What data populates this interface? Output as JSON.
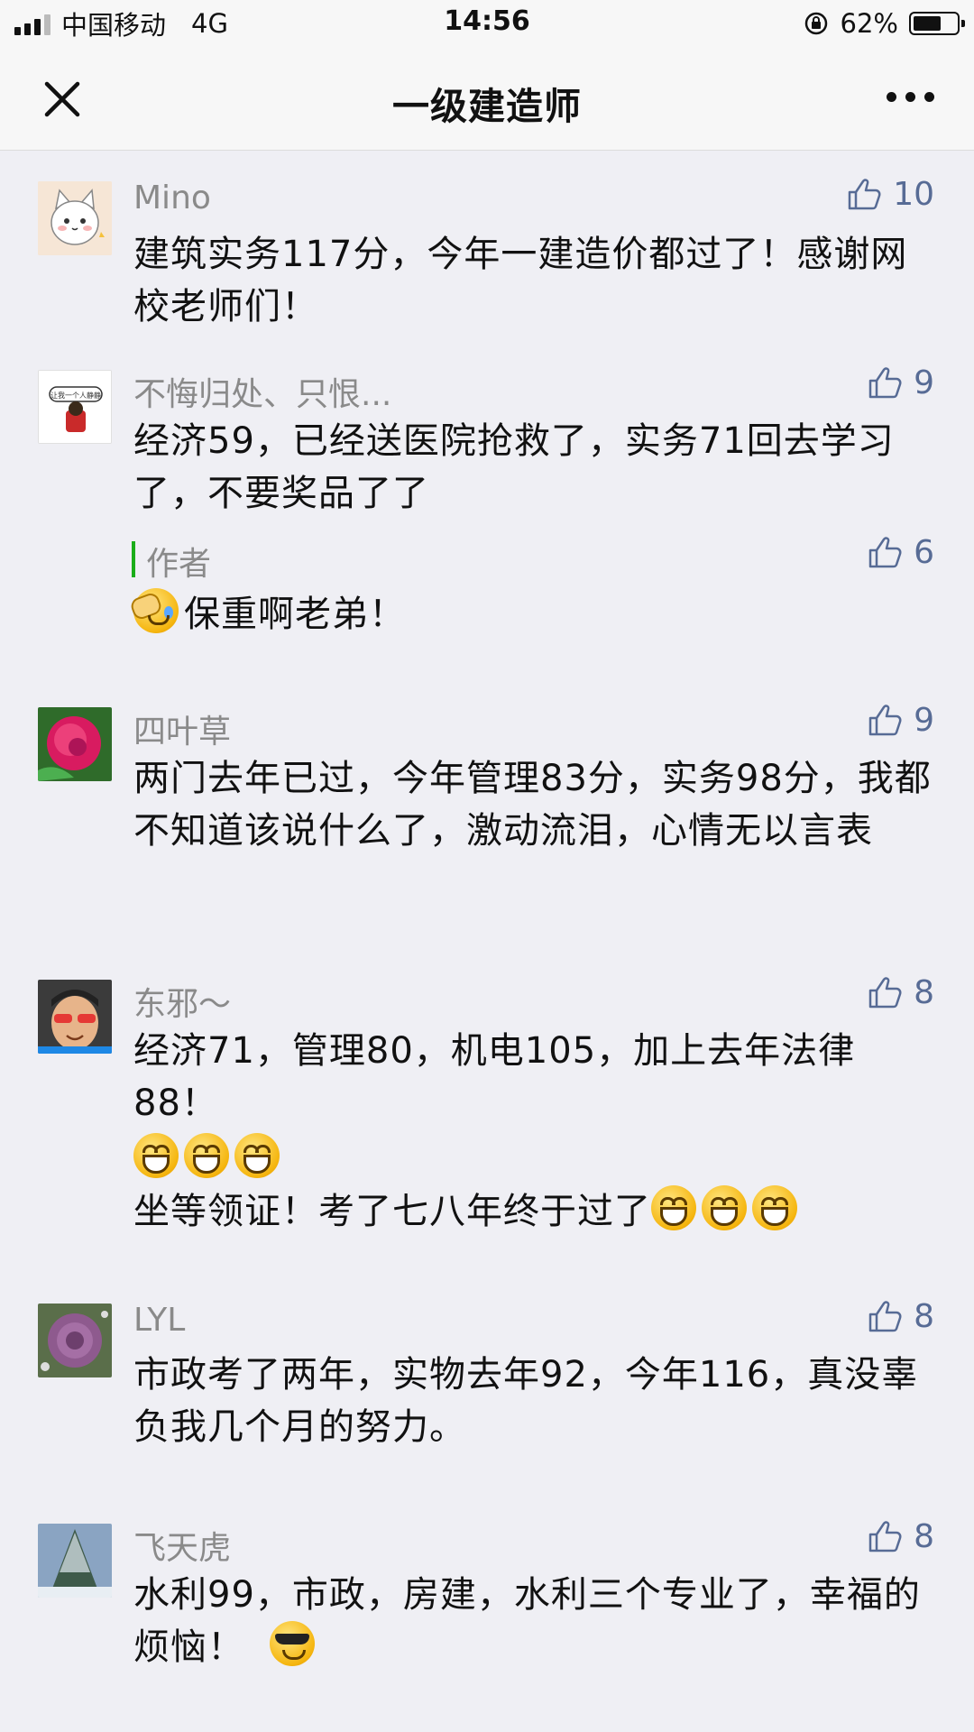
{
  "status": {
    "carrier": "中国移动",
    "network": "4G",
    "time": "14:56",
    "battery": "62%"
  },
  "nav": {
    "title": "一级建造师"
  },
  "comments": [
    {
      "name": "Mino",
      "likes": "10",
      "text": "建筑实务117分，今年一建造价都过了！感谢网校老师们！"
    },
    {
      "name": "不悔归处、只恨...",
      "likes": "9",
      "avatar_text": "让我一个人静静",
      "text": "经济59，已经送医院抢救了，实务71回去学习了，不要奖品了了",
      "reply": {
        "label": "作者",
        "likes": "6",
        "text": "保重啊老弟！"
      }
    },
    {
      "name": "四叶草",
      "likes": "9",
      "text": "两门去年已过，今年管理83分，实务98分，我都不知道该说什么了，激动流泪，心情无以言表"
    },
    {
      "name": "东邪～",
      "likes": "8",
      "text_line1": "经济71，管理80，机电105，加上去年法律88！",
      "text_line3": "坐等领证！考了七八年终于过了"
    },
    {
      "name": "LYL",
      "likes": "8",
      "text": "市政考了两年，实物去年92，今年116，真没辜负我几个月的努力。"
    },
    {
      "name": "飞天虎",
      "likes": "8",
      "text": "水利99，市政，房建，水利三个专业了，幸福的烦恼！"
    }
  ],
  "icons": {
    "like": "thumbs-up-icon",
    "close": "close-icon",
    "more": "more-icon",
    "accent": "#576b95",
    "author_bar": "#1aad19"
  }
}
